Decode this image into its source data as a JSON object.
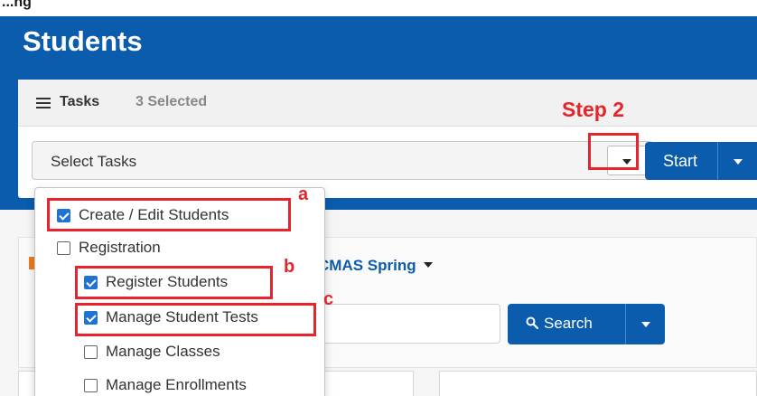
{
  "page": {
    "top_label": "...ng",
    "title": "Students"
  },
  "tasks": {
    "header_label": "Tasks",
    "selected_count_text": "3 Selected",
    "select_placeholder": "Select Tasks",
    "start_label": "Start",
    "options": [
      {
        "label": "Create / Edit Students",
        "checked": true
      },
      {
        "label": "Registration",
        "checked": false
      },
      {
        "label": "Register Students",
        "checked": true
      },
      {
        "label": "Manage Student Tests",
        "checked": true
      },
      {
        "label": "Manage Classes",
        "checked": false
      },
      {
        "label": "Manage Enrollments",
        "checked": false
      }
    ]
  },
  "background": {
    "admin_text": "CMAS Spring",
    "search_label": "Search"
  },
  "annotations": {
    "step_label": "Step 2",
    "letter_a": "a",
    "letter_b": "b",
    "letter_c": "c"
  },
  "colors": {
    "brand_blue": "#0b5cad",
    "annotation_red": "#e8232b",
    "checkbox_blue": "#1f73d6"
  }
}
